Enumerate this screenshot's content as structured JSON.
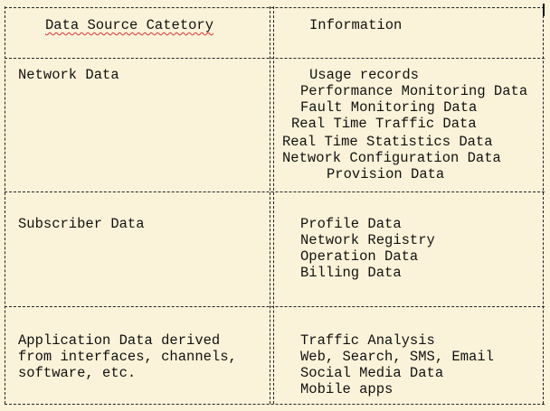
{
  "table": {
    "header": {
      "category": "Data Source Catetory",
      "information": "Information"
    },
    "rows": [
      {
        "category": [
          "Network Data"
        ],
        "information": [
          "Usage records",
          "Performance Monitoring Data",
          "Fault Monitoring Data",
          "Real Time Traffic Data",
          "Real Time Statistics Data",
          "Network Configuration Data",
          "Provision Data"
        ]
      },
      {
        "category": [
          "Subscriber Data"
        ],
        "information": [
          "Profile Data",
          "Network Registry",
          "Operation Data",
          "Billing Data"
        ]
      },
      {
        "category": [
          "Application Data derived",
          "from interfaces, channels,",
          "software, etc."
        ],
        "information": [
          "Traffic Analysis",
          "Web, Search, SMS, Email",
          "Social Media Data",
          "Mobile apps"
        ]
      }
    ]
  }
}
